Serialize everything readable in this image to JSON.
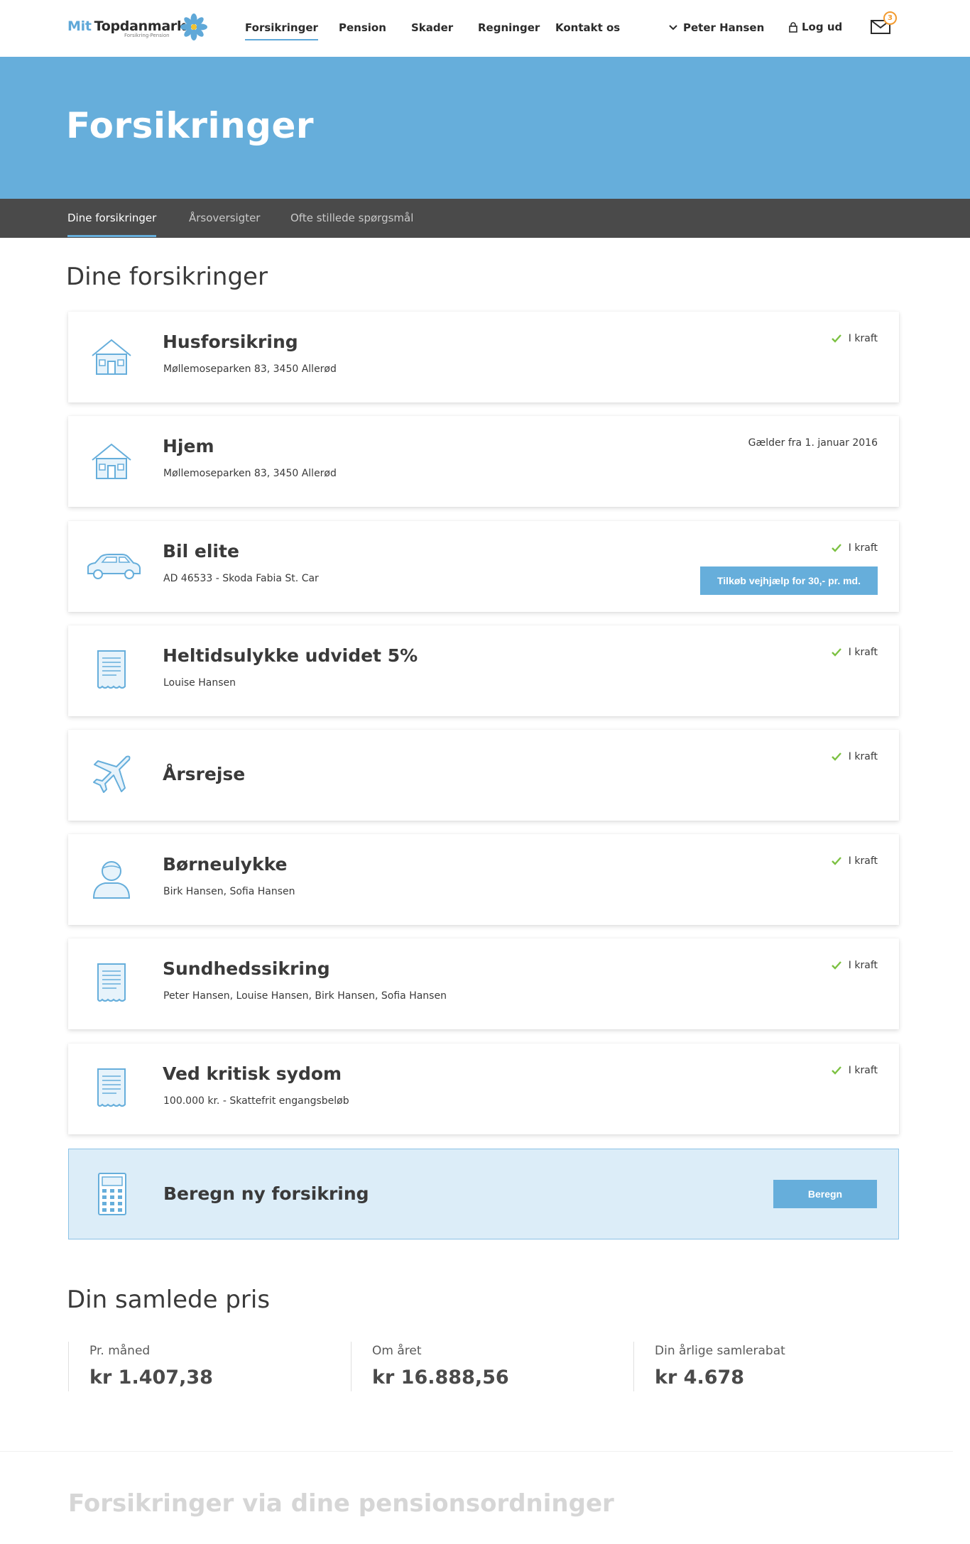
{
  "header": {
    "logo_prefix": "Mit",
    "logo_brand": "Topdanmark",
    "logo_tagline": "Forsikring·Pension",
    "nav": [
      "Forsikringer",
      "Pension",
      "Skader",
      "Regninger",
      "Kontakt os"
    ],
    "user_name": "Peter Hansen",
    "logout_label": "Log ud",
    "mail_badge": "3"
  },
  "hero": {
    "title": "Forsikringer"
  },
  "subnav": [
    "Dine forsikringer",
    "Årsoversigter",
    "Ofte stillede spørgsmål"
  ],
  "insurances": {
    "title": "Dine forsikringer",
    "cards": [
      {
        "icon": "house-icon",
        "title": "Husforsikring",
        "subtitle": "Møllemoseparken 83, 3450 Allerød",
        "status": "I kraft"
      },
      {
        "icon": "house-icon",
        "title": "Hjem",
        "subtitle": "Møllemoseparken 83, 3450 Allerød",
        "status": "Gælder fra 1. januar 2016"
      },
      {
        "icon": "car-icon",
        "title": "Bil elite",
        "subtitle": "AD 46533 - Skoda Fabia St. Car",
        "status": "I kraft",
        "button": "Tilkøb vejhjælp for 30,- pr. md."
      },
      {
        "icon": "document-icon",
        "title": "Heltidsulykke udvidet 5%",
        "subtitle": "Louise Hansen",
        "status": "I kraft"
      },
      {
        "icon": "airplane-icon",
        "title": "Årsrejse",
        "subtitle": "",
        "status": "I kraft"
      },
      {
        "icon": "person-icon",
        "title": "Børneulykke",
        "subtitle": "Birk Hansen, Sofia Hansen",
        "status": "I kraft"
      },
      {
        "icon": "document-icon",
        "title": "Sundhedssikring",
        "subtitle": "Peter Hansen, Louise Hansen, Birk Hansen, Sofia Hansen",
        "status": "I kraft"
      },
      {
        "icon": "document-icon",
        "title": "Ved kritisk sydom",
        "subtitle": "100.000 kr. - Skattefrit engangsbeløb",
        "status": "I kraft"
      }
    ],
    "calculator": {
      "icon": "calculator-icon",
      "title": "Beregn ny forsikring",
      "button": "Beregn"
    }
  },
  "price": {
    "title": "Din samlede pris",
    "items": [
      {
        "label": "Pr. måned",
        "value": "kr 1.407,38"
      },
      {
        "label": "Om året",
        "value": "kr 16.888,56"
      },
      {
        "label": "Din årlige samlerabat",
        "value": "kr 4.678"
      }
    ]
  },
  "pension_section": {
    "title": "Forsikringer via dine pensionsordninger"
  },
  "colors": {
    "accent": "#66aedb",
    "subnav": "#4a4a4a",
    "check": "#7cc142",
    "badge": "#f29a2e"
  }
}
